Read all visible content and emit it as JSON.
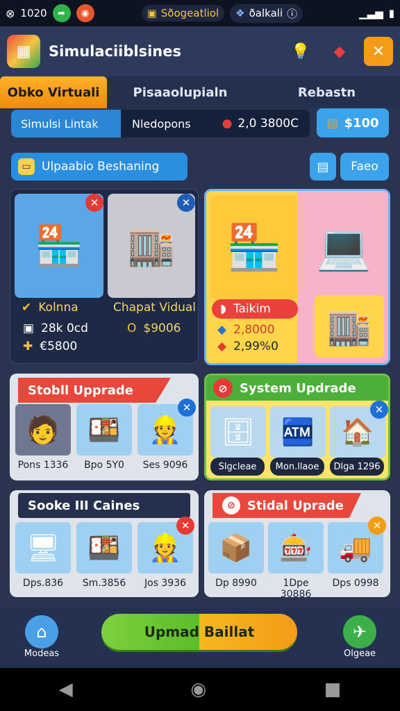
{
  "status": {
    "time": "1020",
    "app_pill": "Sðogeatliol",
    "network": "ðalkali"
  },
  "header": {
    "title": "Simulaciiblsines"
  },
  "tabs": [
    "Obko Virtuali",
    "Pisaaolupialn",
    "Rebastn"
  ],
  "infobar": {
    "label": "Simulsi Lintak",
    "mid": "Nledopons",
    "value": "2,0 3800C"
  },
  "money": {
    "amount": "$100"
  },
  "section": {
    "title": "Ulpaabio Beshaning",
    "right_button": "Faeo"
  },
  "shops": {
    "left": {
      "tiles": [
        "Kolnna",
        "Chapat Vidual"
      ],
      "row1_label": "28k 0cd",
      "row1_value": "$9006",
      "row2_label": "€5800"
    },
    "right": {
      "badge": "Taikim",
      "value1": "2,8000",
      "value2": "2,99%0"
    }
  },
  "cards": [
    {
      "title": "Stobll Upprade",
      "items": [
        "Pons 1336",
        "Bpo 5Y0",
        "Ses 9096"
      ]
    },
    {
      "title": "System Updrade",
      "items": [
        "Slgcleae",
        "Mon.llaoe",
        "Dlga 1296"
      ]
    },
    {
      "title": "Sooke III Caines",
      "items": [
        "Dps.836",
        "Sm.3856",
        "Jos 3936"
      ]
    },
    {
      "title": "Stidal Uprade",
      "items": [
        "Dp 8990",
        "1Dpe 30886",
        "Dps 0998"
      ]
    }
  ],
  "bottom": {
    "upgrade_button": "Upmad Baillat",
    "nav_left": "Modeas",
    "nav_right": "Olgeae"
  },
  "colors": {
    "bg": "#2a3450",
    "accent_orange": "#f39c12",
    "accent_blue": "#3aa3ec",
    "green": "#5cbc2b"
  }
}
